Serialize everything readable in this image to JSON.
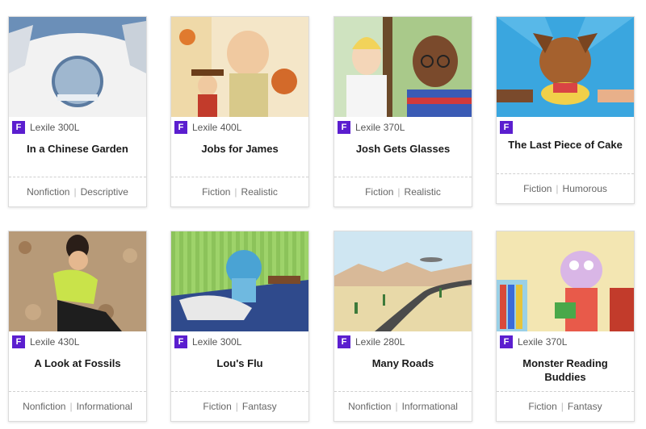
{
  "books": [
    {
      "title": "In a Chinese Garden",
      "lexile": "Lexile 300L",
      "badge": "F",
      "genre": "Nonfiction",
      "subgenre": "Descriptive"
    },
    {
      "title": "Jobs for James",
      "lexile": "Lexile 400L",
      "badge": "F",
      "genre": "Fiction",
      "subgenre": "Realistic"
    },
    {
      "title": "Josh Gets Glasses",
      "lexile": "Lexile 370L",
      "badge": "F",
      "genre": "Fiction",
      "subgenre": "Realistic"
    },
    {
      "title": "The Last Piece of Cake",
      "lexile": "",
      "badge": "F",
      "genre": "Fiction",
      "subgenre": "Humorous"
    },
    {
      "title": "A Look at Fossils",
      "lexile": "Lexile 430L",
      "badge": "F",
      "genre": "Nonfiction",
      "subgenre": "Informational"
    },
    {
      "title": "Lou's Flu",
      "lexile": "Lexile 300L",
      "badge": "F",
      "genre": "Fiction",
      "subgenre": "Fantasy"
    },
    {
      "title": "Many Roads",
      "lexile": "Lexile 280L",
      "badge": "F",
      "genre": "Nonfiction",
      "subgenre": "Informational"
    },
    {
      "title": "Monster Reading Buddies",
      "lexile": "Lexile 370L",
      "badge": "F",
      "genre": "Fiction",
      "subgenre": "Fantasy"
    }
  ],
  "colors": {
    "badge": "#5b1ecf"
  }
}
